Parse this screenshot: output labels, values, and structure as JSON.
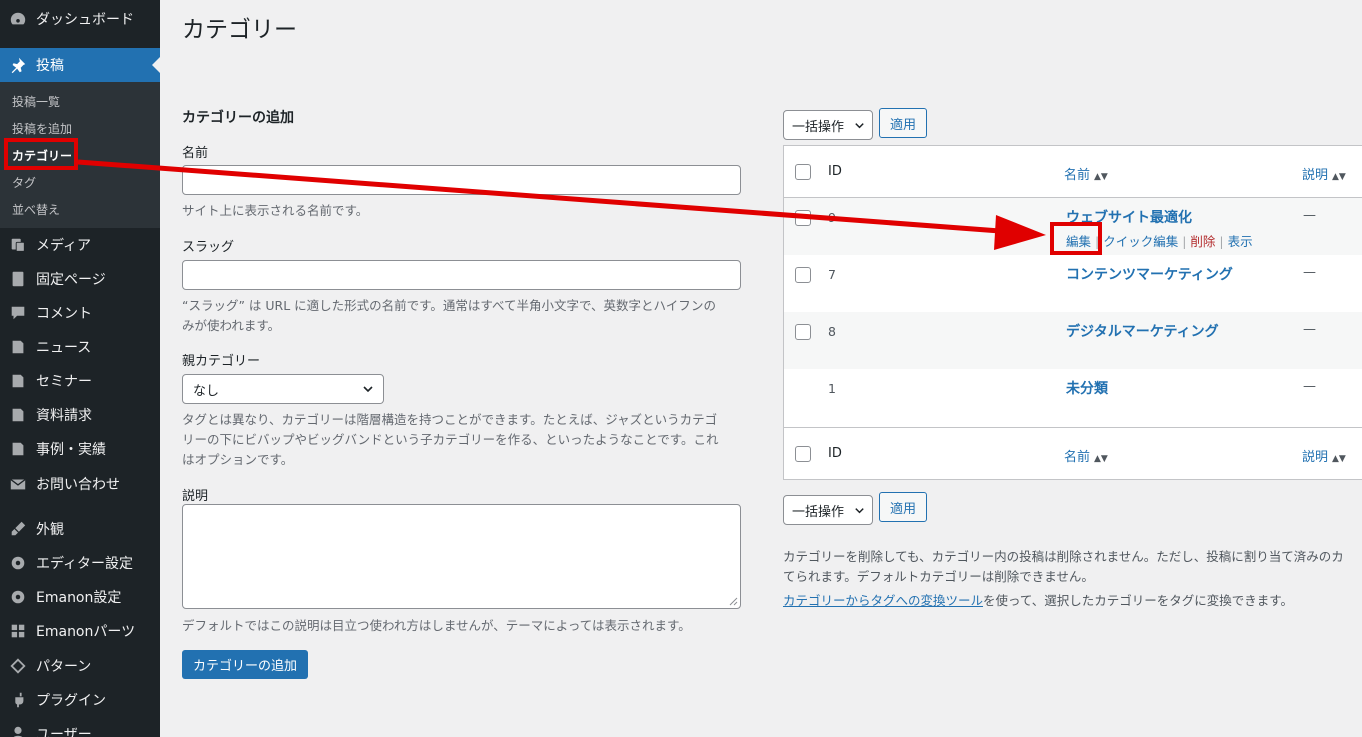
{
  "sidebar": {
    "items": [
      {
        "label": "ダッシュボード",
        "icon": "dashboard-icon"
      },
      {
        "label": "投稿",
        "icon": "pin-icon"
      },
      {
        "label": "メディア",
        "icon": "media-icon"
      },
      {
        "label": "固定ページ",
        "icon": "page-icon"
      },
      {
        "label": "コメント",
        "icon": "comment-icon"
      },
      {
        "label": "ニュース",
        "icon": "post-icon"
      },
      {
        "label": "セミナー",
        "icon": "post-icon"
      },
      {
        "label": "資料請求",
        "icon": "post-icon"
      },
      {
        "label": "事例・実績",
        "icon": "post-icon"
      },
      {
        "label": "お問い合わせ",
        "icon": "mail-icon"
      },
      {
        "label": "外観",
        "icon": "brush-icon"
      },
      {
        "label": "エディター設定",
        "icon": "gear-icon"
      },
      {
        "label": "Emanon設定",
        "icon": "gear-icon"
      },
      {
        "label": "Emanonパーツ",
        "icon": "grid-icon"
      },
      {
        "label": "パターン",
        "icon": "diamond-icon"
      },
      {
        "label": "プラグイン",
        "icon": "plug-icon"
      },
      {
        "label": "ユーザー",
        "icon": "user-icon"
      }
    ],
    "submenu": [
      "投稿一覧",
      "投稿を追加",
      "カテゴリー",
      "タグ",
      "並べ替え"
    ]
  },
  "page": {
    "title": "カテゴリー"
  },
  "form": {
    "heading": "カテゴリーの追加",
    "name_label": "名前",
    "name_help": "サイト上に表示される名前です。",
    "slug_label": "スラッグ",
    "slug_help_1": "“スラッグ” は URL に適した形式の名前です。通常はすべて半角小文字で、英数字とハイフンの",
    "slug_help_2": "みが使われます。",
    "parent_label": "親カテゴリー",
    "parent_value": "なし",
    "parent_help_1": "タグとは異なり、カテゴリーは階層構造を持つことができます。たとえば、ジャズというカテゴ",
    "parent_help_2": "リーの下にビバップやビッグバンドという子カテゴリーを作る、といったようなことです。これ",
    "parent_help_3": "はオプションです。",
    "desc_label": "説明",
    "desc_help": "デフォルトではこの説明は目立つ使われ方はしませんが、テーマによっては表示されます。",
    "submit": "カテゴリーの追加"
  },
  "list": {
    "bulk_label": "一括操作",
    "apply_label": "適用",
    "columns": {
      "id": "ID",
      "name": "名前",
      "description": "説明"
    },
    "rows": [
      {
        "id": "9",
        "name": "ウェブサイト最適化",
        "description": "—"
      },
      {
        "id": "7",
        "name": "コンテンツマーケティング",
        "description": "—"
      },
      {
        "id": "8",
        "name": "デジタルマーケティング",
        "description": "—"
      },
      {
        "id": "1",
        "name": "未分類",
        "description": "—"
      }
    ],
    "row_actions": {
      "edit": "編集",
      "quick_edit": "クイック編集",
      "delete": "削除",
      "view": "表示",
      "sep": "|"
    },
    "note_1": "カテゴリーを削除しても、カテゴリー内の投稿は削除されません。ただし、投稿に割り当て済みのカ",
    "note_2": "てられます。デフォルトカテゴリーは削除できません。",
    "converter_link": "カテゴリーからタグへの変換ツール",
    "converter_text": "を使って、選択したカテゴリーをタグに変換できます。"
  },
  "colors": {
    "accent": "#2271b1",
    "sidebar": "#1d2327",
    "highlight": "#e00000"
  }
}
